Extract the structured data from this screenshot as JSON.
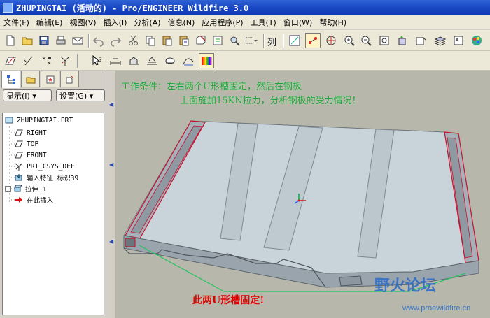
{
  "window": {
    "title": "ZHUPINGTAI (活动的) - Pro/ENGINEER Wildfire 3.0"
  },
  "menubar": {
    "items": [
      "文件(F)",
      "编辑(E)",
      "视图(V)",
      "插入(I)",
      "分析(A)",
      "信息(N)",
      "应用程序(P)",
      "工具(T)",
      "窗口(W)",
      "帮助(H)"
    ]
  },
  "toolbar": {
    "list_label": "列"
  },
  "left_panel": {
    "show_label": "显示(I) ▾",
    "settings_label": "设置(G) ▾",
    "tree": [
      {
        "label": "ZHUPINGTAI.PRT",
        "icon": "part-icon"
      },
      {
        "label": "RIGHT",
        "icon": "datum-plane-icon"
      },
      {
        "label": "TOP",
        "icon": "datum-plane-icon"
      },
      {
        "label": "FRONT",
        "icon": "datum-plane-icon"
      },
      {
        "label": "PRT_CSYS_DEF",
        "icon": "csys-icon"
      },
      {
        "label": "输入特征 标识39",
        "icon": "import-feature-icon"
      },
      {
        "label": "拉伸 1",
        "icon": "extrude-icon"
      },
      {
        "label": "在此插入",
        "icon": "insert-here-arrow-icon"
      }
    ]
  },
  "viewport": {
    "annotation_line1": "工作条件：左右两个U形槽固定，然后在钢板",
    "annotation_line2": "上面施加15KN拉力，分析钢板的受力情况！",
    "callout": "此两U形槽固定!",
    "watermark_cn": "野火论坛",
    "watermark_url": "www.proewildfire.cn"
  },
  "colors": {
    "viewport_bg": "#b7b7ab",
    "model_face": "#c8d2d8",
    "annotation_green": "#1fa63a",
    "callout_red": "#e00000",
    "title_blue": "#1a48c4"
  }
}
